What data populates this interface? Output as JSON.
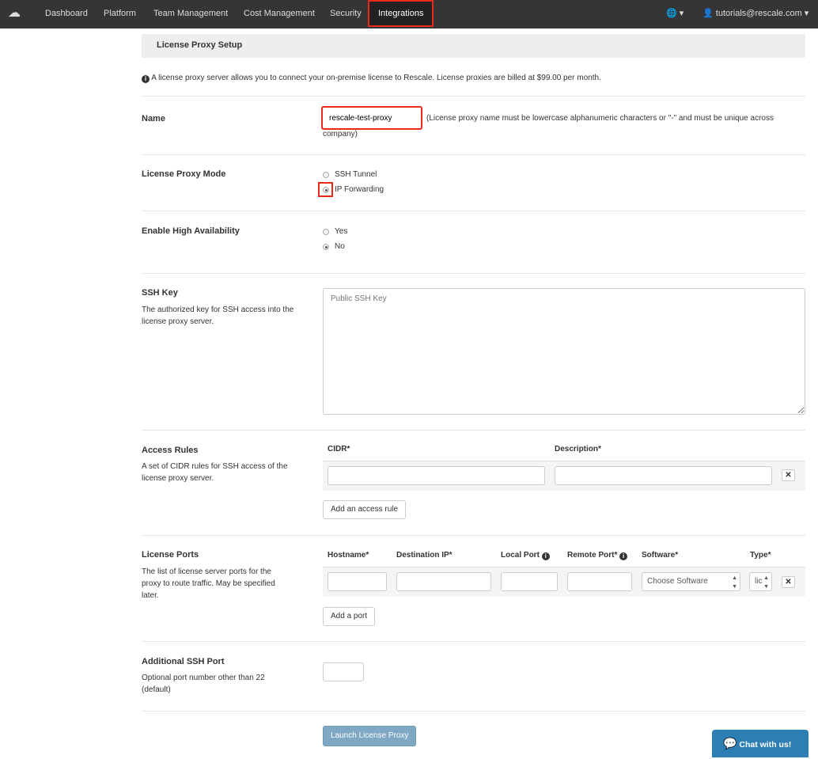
{
  "nav": {
    "items": [
      "Dashboard",
      "Platform",
      "Team Management",
      "Cost Management",
      "Security",
      "Integrations"
    ],
    "active": "Integrations",
    "user": "tutorials@rescale.com"
  },
  "header": {
    "title": "License Proxy Setup"
  },
  "info_text": "A license proxy server allows you to connect your on-premise license to Rescale. License proxies are billed at $99.00 per month.",
  "name": {
    "label": "Name",
    "value": "rescale-test-proxy",
    "hint": "(License proxy name must be lowercase alphanumeric characters or \"-\" and must be unique across",
    "hint2": "company)"
  },
  "mode": {
    "label": "License Proxy Mode",
    "options": [
      "SSH Tunnel",
      "IP Forwarding"
    ],
    "selected": "IP Forwarding"
  },
  "ha": {
    "label": "Enable High Availability",
    "options": [
      "Yes",
      "No"
    ],
    "selected": "No"
  },
  "ssh_key": {
    "label": "SSH Key",
    "desc": "The authorized key for SSH access into the license proxy server.",
    "placeholder": "Public SSH Key"
  },
  "access": {
    "label": "Access Rules",
    "desc": "A set of CIDR rules for SSH access of the license proxy server.",
    "columns": [
      "CIDR*",
      "Description*"
    ],
    "add_label": "Add an access rule"
  },
  "ports": {
    "label": "License Ports",
    "desc": "The list of license server ports for the proxy to route traffic. May be specified later.",
    "columns": [
      "Hostname*",
      "Destination IP*",
      "Local Port",
      "Remote Port*",
      "Software*",
      "Type*"
    ],
    "software_value": "Choose Software",
    "type_value": "lic",
    "add_label": "Add a port"
  },
  "ssh_port": {
    "label": "Additional SSH Port",
    "desc": "Optional port number other than 22 (default)"
  },
  "launch_label": "Launch License Proxy",
  "chat_label": "Chat with us!",
  "colors": {
    "nav": "#353535",
    "highlight": "#e8291c",
    "launch": "#7fa8c4",
    "chat": "#2d7eb5"
  }
}
